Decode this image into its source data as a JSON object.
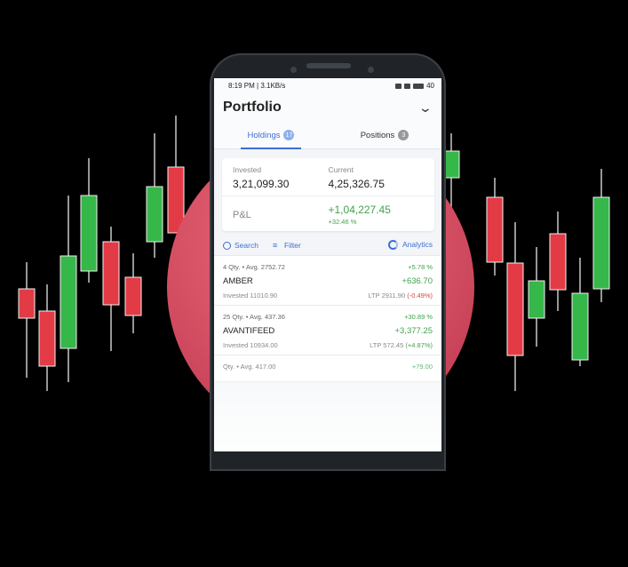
{
  "status_bar": {
    "time": "8:19 PM | 3.1KB/s",
    "battery": "40"
  },
  "header": {
    "title": "Portfolio"
  },
  "tabs": [
    {
      "label": "Holdings",
      "count": "17",
      "active": true
    },
    {
      "label": "Positions",
      "count": "3",
      "active": false
    }
  ],
  "summary": {
    "invested_label": "Invested",
    "invested_value": "3,21,099.30",
    "current_label": "Current",
    "current_value": "4,25,326.75",
    "pl_label": "P&L",
    "pl_value": "+1,04,227.45",
    "pl_percent": "+32.46 %"
  },
  "toolbar": {
    "search": "Search",
    "filter": "Filter",
    "analytics": "Analytics"
  },
  "holdings": [
    {
      "qty_avg": "4 Qty. • Avg. 2752.72",
      "pct": "+5.78 %",
      "symbol": "AMBER",
      "pnl": "+636.70",
      "invested": "Invested 11010.90",
      "ltp": "LTP 2911.90",
      "ltp_change": "(-0.49%)"
    },
    {
      "qty_avg": "25 Qty. • Avg. 437.36",
      "pct": "+30.89 %",
      "symbol": "AVANTIFEED",
      "pnl": "+3,377.25",
      "invested": "Invested 10934.00",
      "ltp": "LTP 572.45",
      "ltp_change": "(+4.87%)"
    },
    {
      "qty_avg": "Qty. • Avg. 417.00",
      "pct": "+79.00",
      "symbol": "",
      "pnl": "",
      "invested": "",
      "ltp": "",
      "ltp_change": ""
    }
  ],
  "colors": {
    "accent": "#3d6fd6",
    "gain": "#3fa34d",
    "loss": "#d64545",
    "circle": "#d95366"
  },
  "icons": [
    "search-icon",
    "filter-icon",
    "analytics-icon",
    "chevron-down-icon"
  ]
}
